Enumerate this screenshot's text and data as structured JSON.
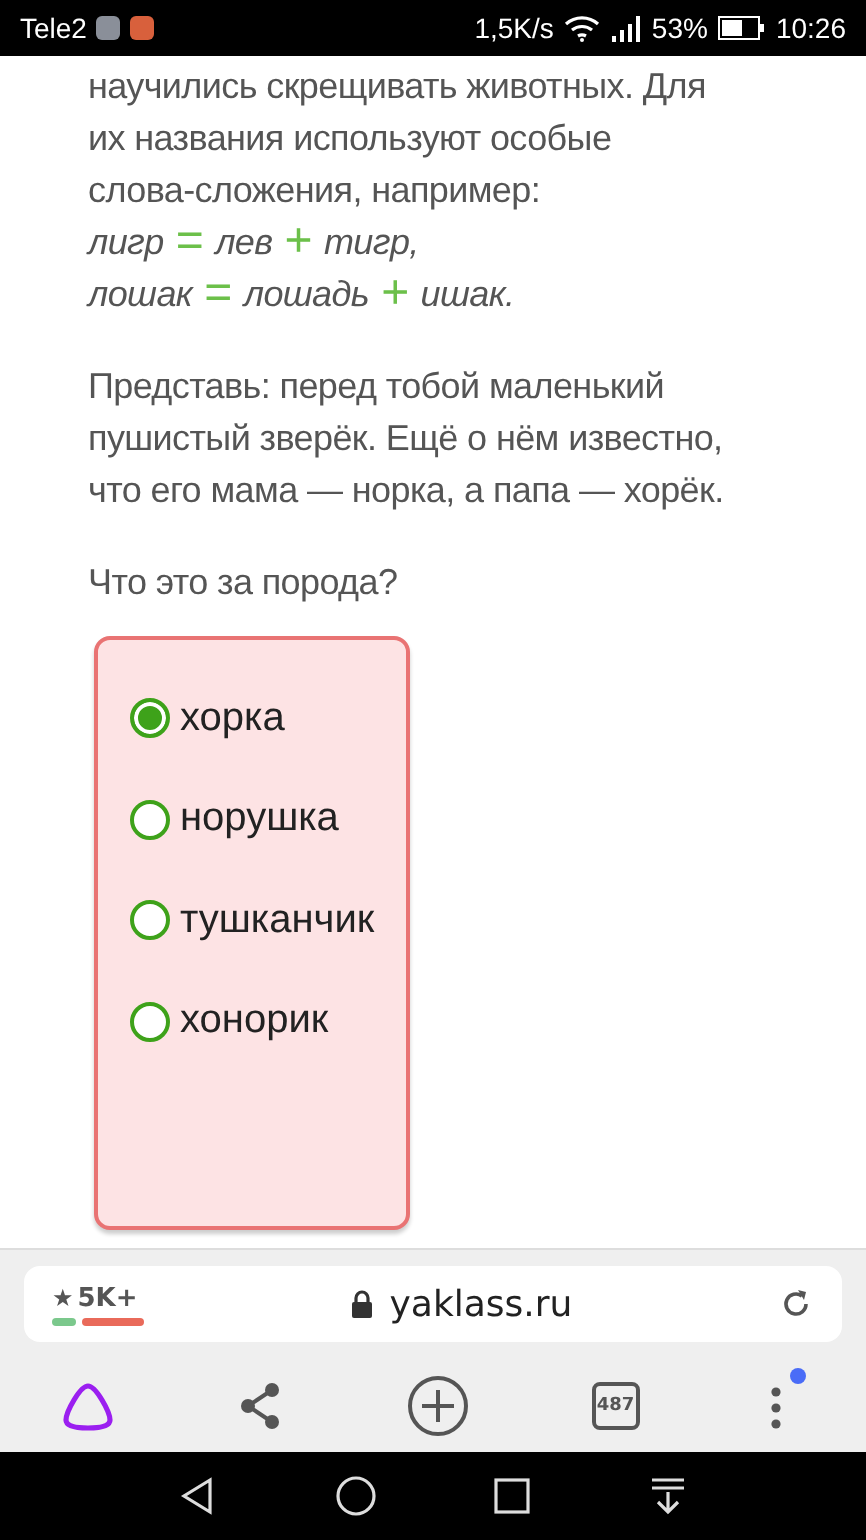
{
  "status_bar": {
    "carrier": "Tele2",
    "speed": "1,5K/s",
    "battery_text": "53%",
    "time": "10:26"
  },
  "article": {
    "intro_lines": [
      "научились скрещивать животных. Для",
      "их названия используют особые",
      "слова-сложения, например:"
    ],
    "formulas": [
      [
        {
          "kind": "word",
          "text": "лигр"
        },
        {
          "kind": "op",
          "text": "="
        },
        {
          "kind": "word",
          "text": "лев"
        },
        {
          "kind": "op",
          "text": "+"
        },
        {
          "kind": "word",
          "text": "тигр,"
        }
      ],
      [
        {
          "kind": "word",
          "text": "лошак"
        },
        {
          "kind": "op",
          "text": "="
        },
        {
          "kind": "word",
          "text": "лошадь"
        },
        {
          "kind": "op",
          "text": "+"
        },
        {
          "kind": "word",
          "text": "ишак."
        }
      ]
    ],
    "paragraph": "Представь: перед тобой маленький пушистый зверёк. Ещё о нём известно, что его мама — норка, а папа — хорёк.",
    "question": "Что это за порода?"
  },
  "options": [
    {
      "label": "хорка",
      "selected": true
    },
    {
      "label": "норушка",
      "selected": false
    },
    {
      "label": "тушканчик",
      "selected": false
    },
    {
      "label": "хонорик",
      "selected": false
    }
  ],
  "browser": {
    "rating_symbol": "★",
    "rating": "5K+",
    "rating_bar": {
      "level": 0.25
    },
    "url": "yaklass.ru",
    "tabs_count": "487",
    "menu_notification": true
  }
}
